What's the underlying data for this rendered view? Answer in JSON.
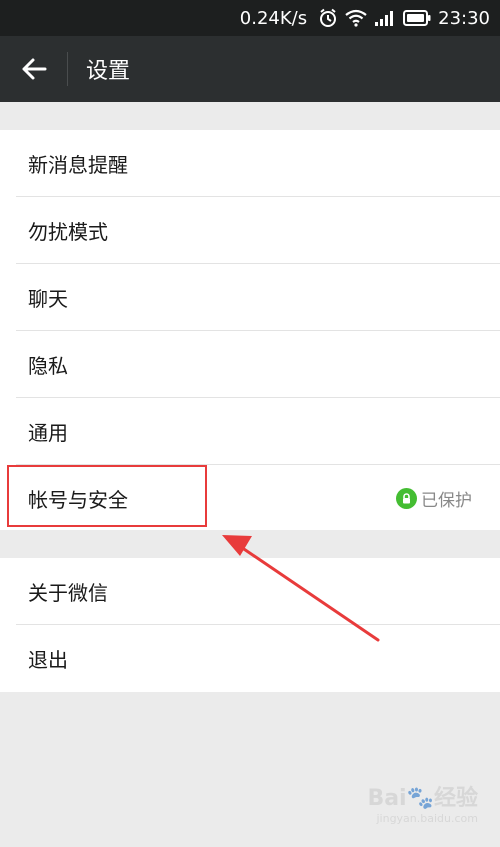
{
  "status_bar": {
    "net_speed": "0.24K/s",
    "time": "23:30",
    "icons": [
      "alarm-icon",
      "wifi-icon",
      "signal-icon",
      "battery-icon"
    ]
  },
  "header": {
    "title": "设置",
    "back_icon": "arrow-left-icon"
  },
  "settings": {
    "group1": [
      {
        "label": "新消息提醒"
      },
      {
        "label": "勿扰模式"
      },
      {
        "label": "聊天"
      },
      {
        "label": "隐私"
      },
      {
        "label": "通用"
      },
      {
        "label": "帐号与安全",
        "status": "已保护",
        "status_icon": "lock-icon"
      }
    ],
    "group2": [
      {
        "label": "关于微信"
      },
      {
        "label": "退出"
      }
    ]
  },
  "watermark": {
    "logo": "Bai🐾经验",
    "url": "jingyan.baidu.com"
  },
  "colors": {
    "status_bar_bg": "#1d1f1f",
    "title_bar_bg": "#2c2f30",
    "page_bg": "#ebebeb",
    "protected_green": "#44bd32",
    "annotation_red": "#e83b3b"
  }
}
